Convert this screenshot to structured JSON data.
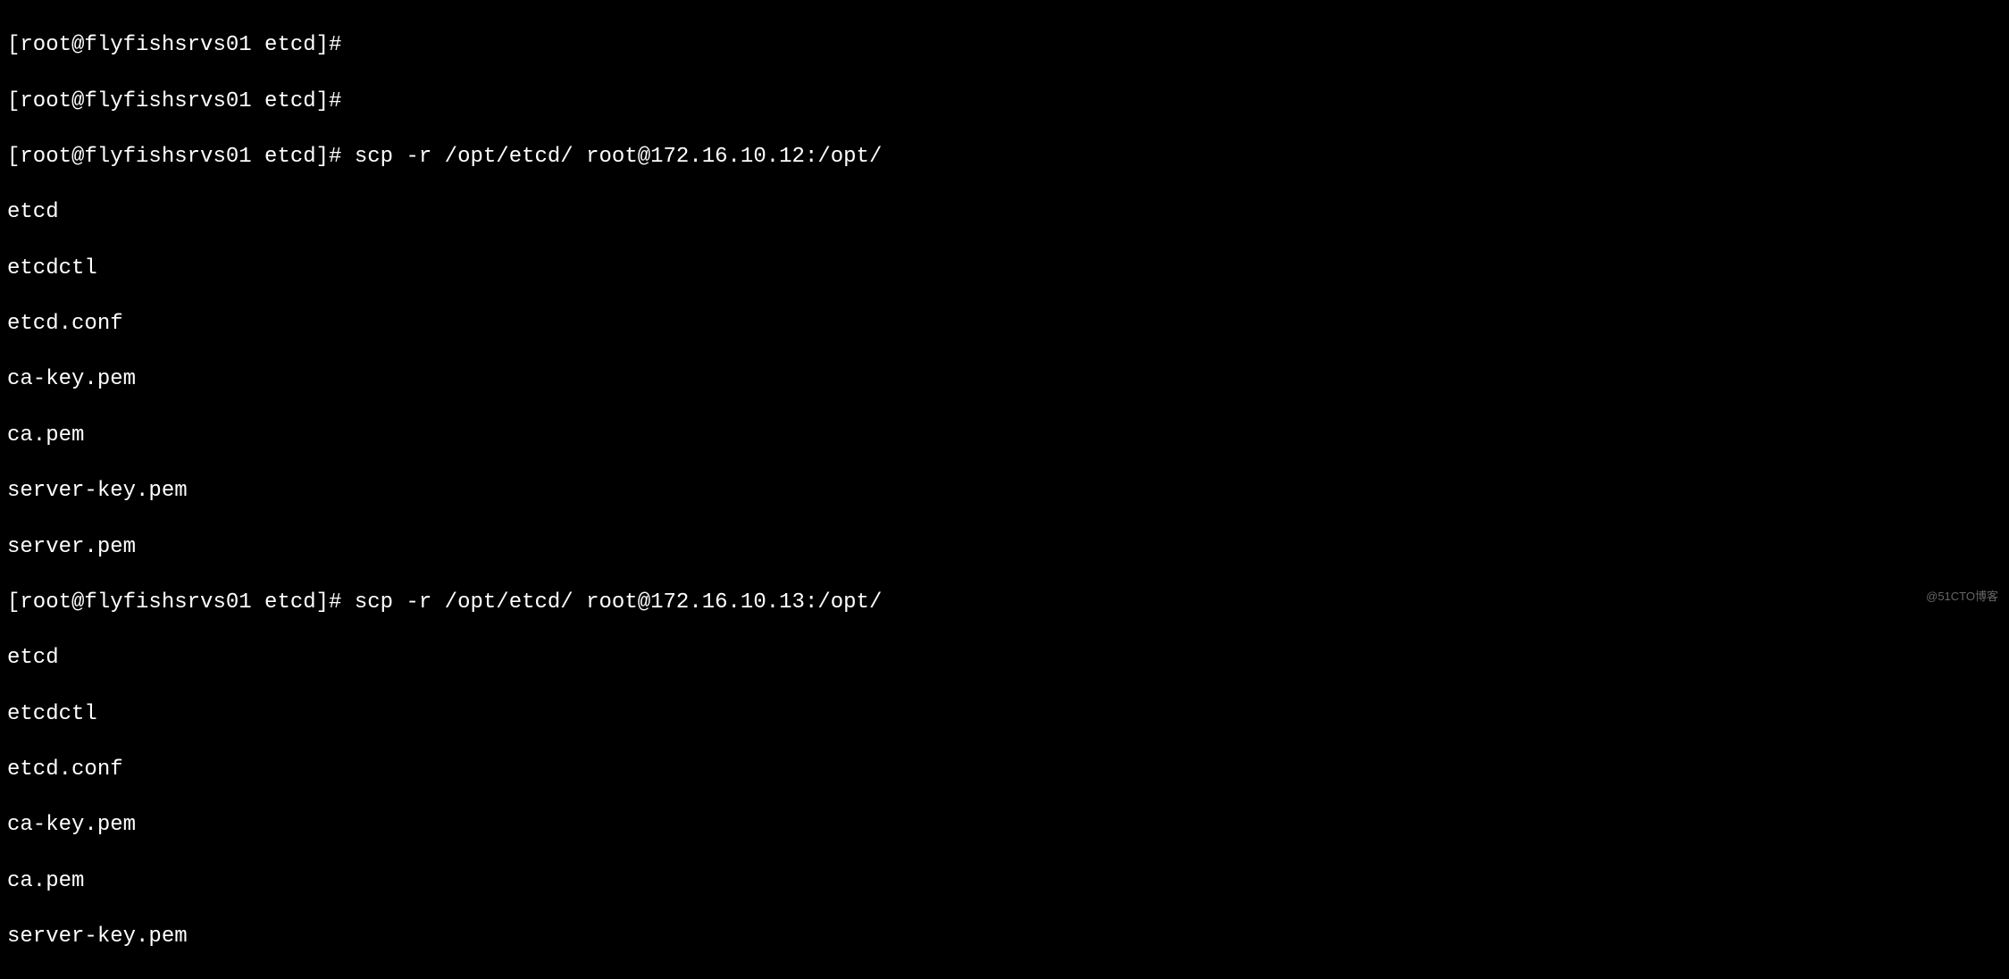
{
  "terminal": {
    "lines": [
      "[root@flyfishsrvs01 etcd]# ",
      "[root@flyfishsrvs01 etcd]# ",
      "[root@flyfishsrvs01 etcd]# scp -r /opt/etcd/ root@172.16.10.12:/opt/",
      "etcd",
      "etcdctl",
      "etcd.conf",
      "ca-key.pem",
      "ca.pem",
      "server-key.pem",
      "server.pem",
      "[root@flyfishsrvs01 etcd]# scp -r /opt/etcd/ root@172.16.10.13:/opt/",
      "etcd",
      "etcdctl",
      "etcd.conf",
      "ca-key.pem",
      "ca.pem",
      "server-key.pem"
    ]
  },
  "watermark": "@51CTO博客"
}
